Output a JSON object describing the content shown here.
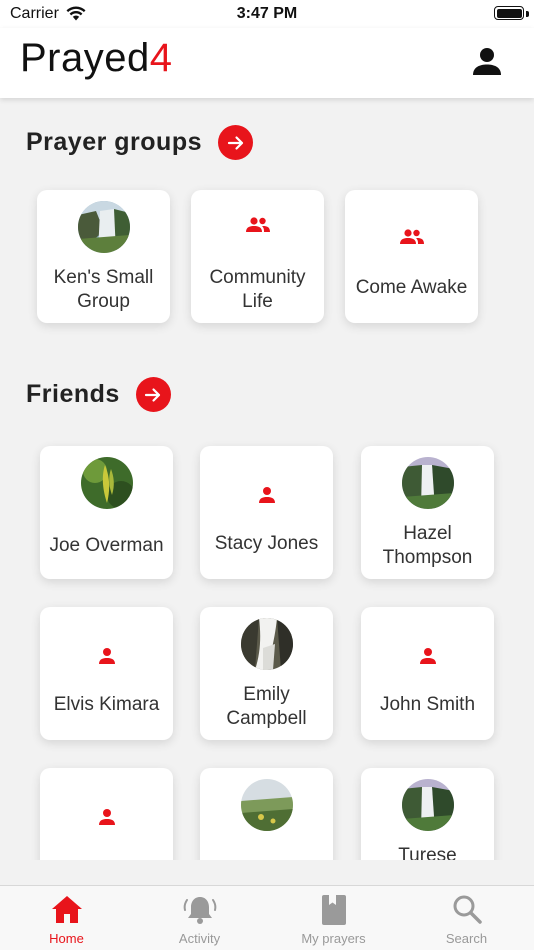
{
  "status_bar": {
    "carrier": "Carrier",
    "time": "3:47 PM"
  },
  "header": {
    "title_main": "Prayed",
    "title_accent": "4"
  },
  "colors": {
    "accent": "#e8141b",
    "background": "#f2f2f2",
    "card": "#ffffff",
    "tab_inactive": "#999999"
  },
  "prayer_groups": {
    "title": "Prayer groups",
    "items": [
      {
        "label": "Ken's Small Group",
        "icon": "photo-avatar"
      },
      {
        "label": "Community Life",
        "icon": "group-icon"
      },
      {
        "label": "Come Awake",
        "icon": "group-icon"
      }
    ]
  },
  "friends": {
    "title": "Friends",
    "items": [
      {
        "label": "Joe Overman",
        "icon": "photo-avatar"
      },
      {
        "label": "Stacy Jones",
        "icon": "person-icon"
      },
      {
        "label": "Hazel Thompson",
        "icon": "photo-avatar"
      },
      {
        "label": "Elvis Kimara",
        "icon": "person-icon"
      },
      {
        "label": "Emily Campbell",
        "icon": "photo-avatar"
      },
      {
        "label": "John Smith",
        "icon": "person-icon"
      },
      {
        "label": "",
        "icon": "person-icon"
      },
      {
        "label": "",
        "icon": "photo-avatar"
      },
      {
        "label": "Turese",
        "icon": "photo-avatar"
      }
    ]
  },
  "tabs": [
    {
      "label": "Home",
      "icon": "home-icon",
      "active": true
    },
    {
      "label": "Activity",
      "icon": "bell-icon",
      "active": false
    },
    {
      "label": "My prayers",
      "icon": "book-icon",
      "active": false
    },
    {
      "label": "Search",
      "icon": "search-icon",
      "active": false
    }
  ]
}
